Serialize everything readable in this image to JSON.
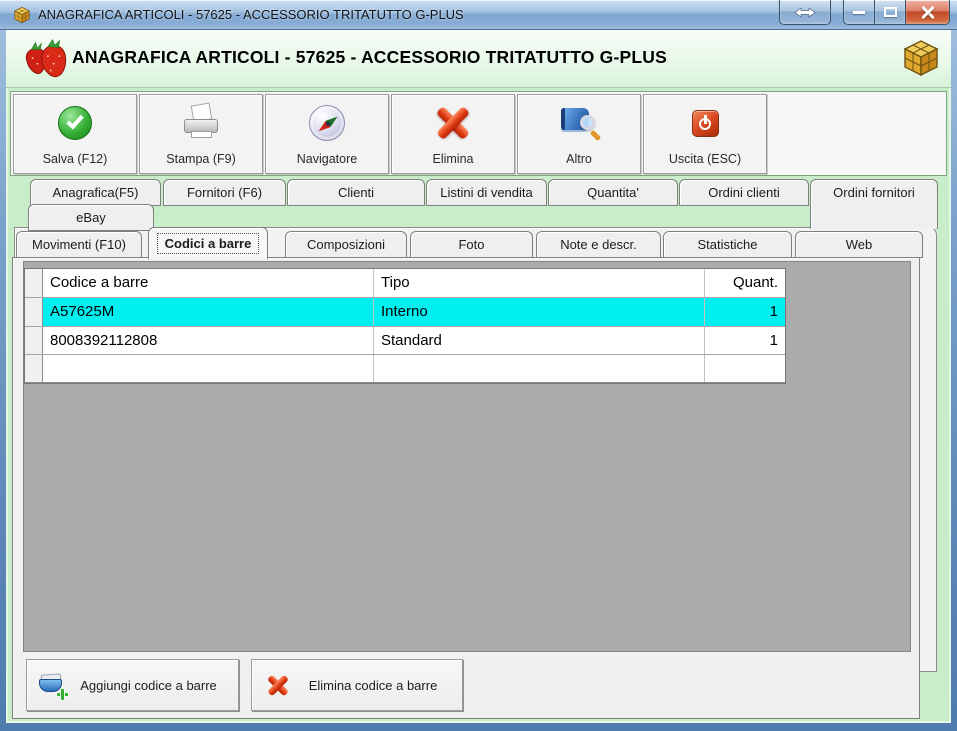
{
  "window": {
    "title": "ANAGRAFICA ARTICOLI - 57625 - ACCESSORIO TRITATUTTO G-PLUS"
  },
  "header": {
    "title": "ANAGRAFICA ARTICOLI - 57625 - ACCESSORIO TRITATUTTO G-PLUS"
  },
  "toolbar": {
    "buttons": [
      {
        "label": "Salva (F12)",
        "icon": "save-check-icon"
      },
      {
        "label": "Stampa (F9)",
        "icon": "printer-icon"
      },
      {
        "label": "Navigatore",
        "icon": "compass-icon"
      },
      {
        "label": "Elimina",
        "icon": "red-x-icon"
      },
      {
        "label": "Altro",
        "icon": "book-search-icon"
      },
      {
        "label": "Uscita (ESC)",
        "icon": "power-icon"
      }
    ]
  },
  "tabs": {
    "row1": [
      "Anagrafica(F5)",
      "Fornitori (F6)",
      "Clienti",
      "Listini di vendita",
      "Quantita'",
      "Ordini clienti",
      "Ordini fornitori"
    ],
    "row2": [
      "eBay"
    ],
    "row3": [
      "Movimenti (F10)",
      "Codici a barre",
      "Composizioni",
      "Foto",
      "Note e descr.",
      "Statistiche",
      "Web"
    ],
    "active_tab": "Codici a barre"
  },
  "table": {
    "columns": [
      "Codice a barre",
      "Tipo",
      "Quant."
    ],
    "rows": [
      {
        "codice": "A57625M",
        "tipo": "Interno",
        "quant": "1",
        "selected": true
      },
      {
        "codice": "8008392112808",
        "tipo": "Standard",
        "quant": "1",
        "selected": false
      },
      {
        "codice": "",
        "tipo": "",
        "quant": "",
        "selected": false
      }
    ]
  },
  "footer": {
    "add_label": "Aggiungi codice a barre",
    "delete_label": "Elimina codice a barre"
  },
  "colors": {
    "selection": "#00f0f0",
    "client_green": "#c9ecc9",
    "titlebar_blue": "#8db1d6",
    "close_red": "#c2482a"
  }
}
